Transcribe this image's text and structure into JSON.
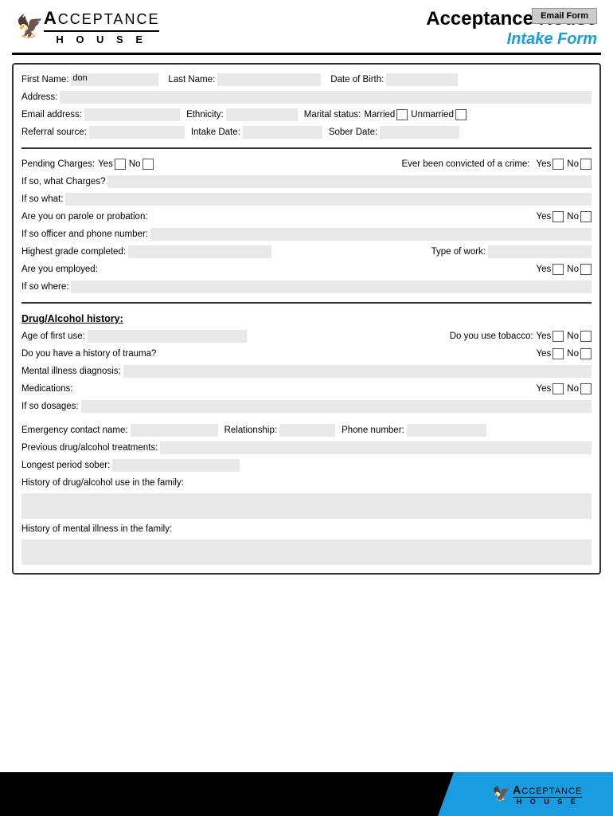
{
  "header": {
    "email_form_label": "Email Form",
    "title_main": "Acceptance House",
    "title_sub": "Intake Form",
    "logo_acceptance": "CCEPTANCE",
    "logo_house": "H O U S E"
  },
  "personal": {
    "first_name_label": "First Name:",
    "first_name_value": "don",
    "last_name_label": "Last Name:",
    "last_name_value": "",
    "dob_label": "Date of Birth:",
    "dob_value": "",
    "address_label": "Address:",
    "address_value": "",
    "email_label": "Email address:",
    "email_value": "",
    "ethnicity_label": "Ethnicity:",
    "ethnicity_value": "",
    "marital_label": "Marital status:",
    "married_label": "Married",
    "unmarried_label": "Unmarried",
    "referral_label": "Referral source:",
    "referral_value": "",
    "intake_label": "Intake Date:",
    "intake_value": "",
    "sober_label": "Sober Date:",
    "sober_value": ""
  },
  "legal": {
    "pending_label": "Pending Charges:",
    "yes_label": "Yes",
    "no_label": "No",
    "convicted_label": "Ever been convicted of a crime:",
    "if_charges_label": "If so, what Charges?",
    "if_charges_value": "",
    "if_so_what_label": "If so what:",
    "if_so_what_value": "",
    "parole_label": "Are you on parole or probation:",
    "officer_label": "If so officer and phone number:",
    "officer_value": "",
    "grade_label": "Highest grade completed:",
    "grade_value": "",
    "work_type_label": "Type of work:",
    "work_type_value": "",
    "employed_label": "Are you employed:",
    "if_where_label": "If so where:",
    "if_where_value": ""
  },
  "drug": {
    "section_title": "Drug/Alcohol history:",
    "age_label": "Age of first use:",
    "age_value": "",
    "tobacco_label": "Do you use tobacco:",
    "trauma_label": "Do you have a history of trauma?",
    "mental_label": "Mental illness diagnosis:",
    "mental_value": "",
    "meds_label": "Medications:",
    "dosages_label": "If so dosages:",
    "dosages_value": "",
    "emergency_name_label": "Emergency contact name:",
    "emergency_name_value": "",
    "relationship_label": "Relationship:",
    "relationship_value": "",
    "phone_label": "Phone number:",
    "phone_value": "",
    "prev_treatment_label": "Previous drug/alcohol treatments:",
    "prev_treatment_value": "",
    "longest_sober_label": "Longest period sober:",
    "longest_sober_value": "",
    "family_history_label": "History of drug/alcohol use in the family:",
    "family_history_value": "",
    "mental_family_label": "History of mental illness in the family:",
    "mental_family_value": ""
  },
  "yes_label": "Yes",
  "no_label": "No"
}
